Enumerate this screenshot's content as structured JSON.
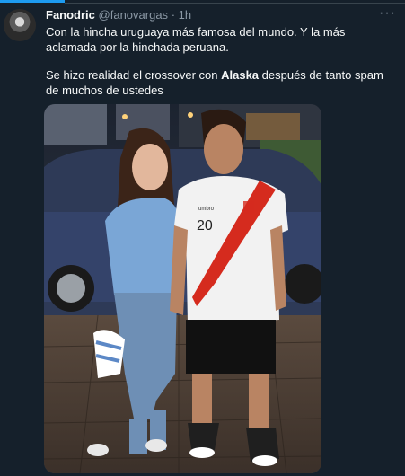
{
  "header": {
    "display_name": "Fanodric",
    "handle": "@fanovargas",
    "separator": "·",
    "time": "1h",
    "more_icon": "ellipsis-icon"
  },
  "tweet": {
    "line1": "Con la hincha uruguaya más famosa del mundo. Y la más aclamada por la hinchada peruana.",
    "line2_pre": "Se hizo realidad el crossover con ",
    "line2_bold": "Alaska",
    "line2_post": " después de tanto spam de muchos de ustedes"
  },
  "media": {
    "jersey_number": "20",
    "brand_label": "umbro"
  },
  "colors": {
    "background": "#15202b",
    "accent": "#1d9bf0",
    "text": "#f7f9f9",
    "secondary_text": "#8b98a5",
    "peru_red": "#d52b1e",
    "uruguay_blue": "#7aa6d6"
  }
}
